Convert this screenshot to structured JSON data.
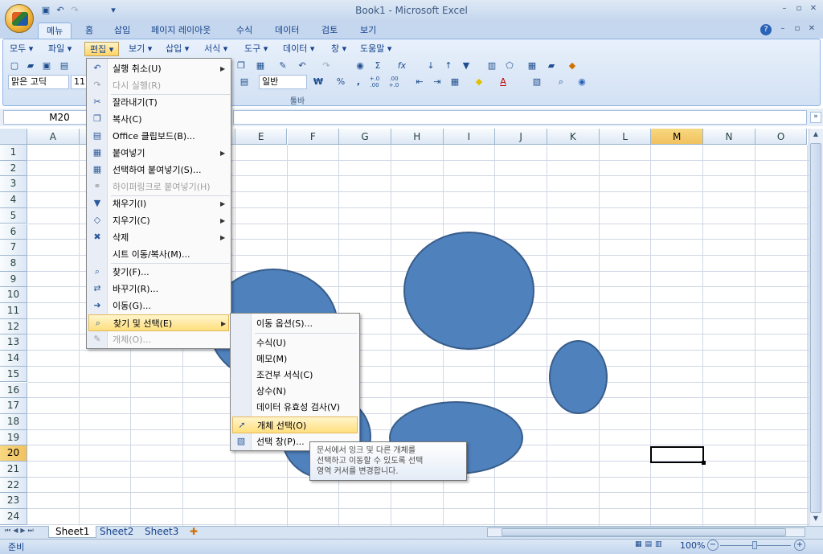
{
  "window": {
    "title": "Book1 - Microsoft Excel",
    "help": "?"
  },
  "qat": {
    "save_icon": "save-icon",
    "undo_icon": "undo-icon",
    "redo_icon": "redo-icon"
  },
  "ribbon_tabs": [
    "메뉴",
    "홈",
    "삽입",
    "페이지 레이아웃",
    "수식",
    "데이터",
    "검토",
    "보기"
  ],
  "classic_menu": [
    "모두 ▾",
    "파일 ▾",
    "편집 ▾",
    "보기 ▾",
    "삽입 ▾",
    "서식 ▾",
    "도구 ▾",
    "데이터 ▾",
    "창 ▾",
    "도움말 ▾"
  ],
  "toolbar": {
    "font_name": "맑은 고딕",
    "font_size": "11",
    "number_format": "일반",
    "label": "툴바",
    "currency": "₩",
    "percent": "%",
    "comma": ",",
    "inc_decimal": "+.0 .00",
    "dec_decimal": ".00 +.0"
  },
  "formula_bar": {
    "name_box": "M20",
    "fx_value": ""
  },
  "columns": [
    "A",
    "B",
    "C",
    "D",
    "E",
    "F",
    "G",
    "H",
    "I",
    "J",
    "K",
    "L",
    "M",
    "N",
    "O"
  ],
  "rows": [
    "1",
    "2",
    "3",
    "4",
    "5",
    "6",
    "7",
    "8",
    "9",
    "10",
    "11",
    "12",
    "13",
    "14",
    "15",
    "16",
    "17",
    "18",
    "19",
    "20",
    "21",
    "22",
    "23",
    "24"
  ],
  "selected_cell": "M20",
  "edit_menu": {
    "items": [
      {
        "label": "실행 취소(U)",
        "icon": "undo-icon",
        "submenu": true,
        "disabled": false
      },
      {
        "label": "다시 실행(R)",
        "icon": "redo-icon",
        "submenu": false,
        "disabled": true
      },
      {
        "label": "잘라내기(T)",
        "icon": "scissors-icon",
        "submenu": false,
        "disabled": false
      },
      {
        "label": "복사(C)",
        "icon": "copy-icon",
        "submenu": false,
        "disabled": false
      },
      {
        "label": "Office 클립보드(B)...",
        "icon": "clipboard-icon",
        "submenu": false,
        "disabled": false
      },
      {
        "label": "붙여넣기",
        "icon": "paste-icon",
        "submenu": true,
        "disabled": false
      },
      {
        "label": "선택하여 붙여넣기(S)...",
        "icon": "paste-special-icon",
        "submenu": false,
        "disabled": false
      },
      {
        "label": "하이퍼링크로 붙여넣기(H)",
        "icon": "paste-link-icon",
        "submenu": false,
        "disabled": true
      },
      {
        "label": "채우기(I)",
        "icon": "fill-icon",
        "submenu": true,
        "disabled": false
      },
      {
        "label": "지우기(C)",
        "icon": "eraser-icon",
        "submenu": true,
        "disabled": false
      },
      {
        "label": "삭제",
        "icon": "delete-icon",
        "submenu": true,
        "disabled": false
      },
      {
        "label": "시트 이동/복사(M)...",
        "icon": "",
        "submenu": false,
        "disabled": false
      },
      {
        "label": "찾기(F)...",
        "icon": "binoculars-icon",
        "submenu": false,
        "disabled": false
      },
      {
        "label": "바꾸기(R)...",
        "icon": "replace-icon",
        "submenu": false,
        "disabled": false
      },
      {
        "label": "이동(G)...",
        "icon": "goto-arrow-icon",
        "submenu": false,
        "disabled": false
      },
      {
        "label": "찾기 및 선택(E)",
        "icon": "binoculars-icon",
        "submenu": true,
        "disabled": false,
        "highlighted": true
      },
      {
        "label": "개체(O)...",
        "icon": "object-icon",
        "submenu": false,
        "disabled": true
      }
    ]
  },
  "find_select_submenu": {
    "items": [
      {
        "label": "이동 옵션(S)...",
        "highlighted": false
      },
      {
        "label": "수식(U)",
        "highlighted": false
      },
      {
        "label": "메모(M)",
        "highlighted": false
      },
      {
        "label": "조건부 서식(C)",
        "highlighted": false
      },
      {
        "label": "상수(N)",
        "highlighted": false
      },
      {
        "label": "데이터 유효성 검사(V)",
        "highlighted": false
      },
      {
        "label": "개체 선택(O)",
        "highlighted": true,
        "icon": "cursor-arrow-icon"
      },
      {
        "label": "선택 창(P)...",
        "highlighted": false,
        "icon": "selection-pane-icon"
      }
    ]
  },
  "tooltip": {
    "line1": "문서에서 잉크 및 다른 개체를",
    "line2": "선택하고 이동할 수 있도록 선택",
    "line3": "영역 커서를 변경합니다."
  },
  "sheets": [
    "Sheet1",
    "Sheet2",
    "Sheet3"
  ],
  "status": {
    "ready": "준비",
    "zoom": "100%"
  },
  "colors": {
    "shape_fill": "#4f81bd",
    "shape_border": "#385d8a",
    "highlight": "#ffdf7e"
  }
}
